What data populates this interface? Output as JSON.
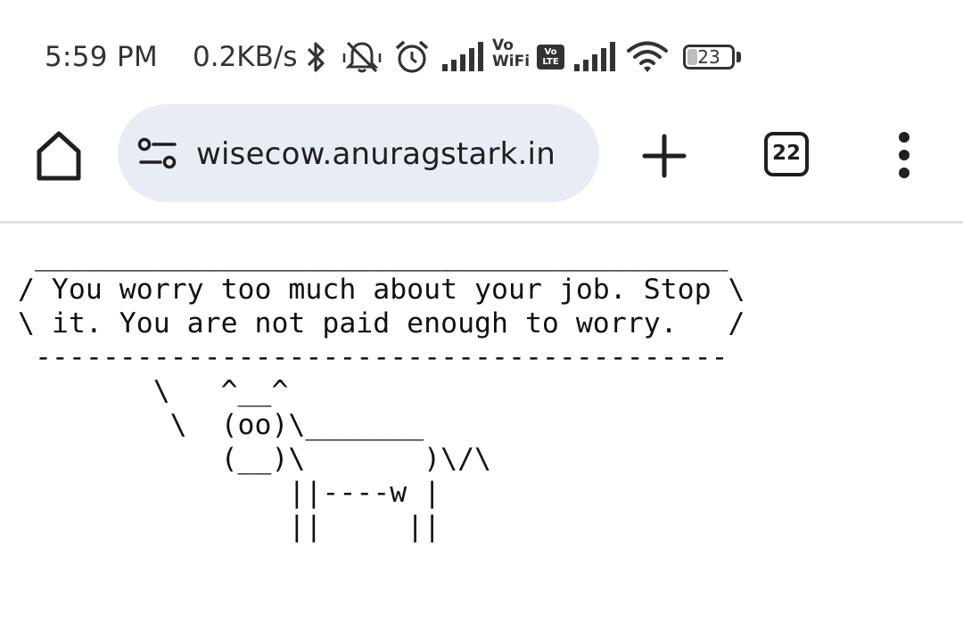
{
  "status_bar": {
    "time": "5:59 PM",
    "net_speed": "0.2KB/s",
    "icons": [
      "bluetooth-icon",
      "mute-icon",
      "alarm-icon",
      "signal-icon",
      "vowifi-icon",
      "volte-icon",
      "signal-icon",
      "wifi-icon",
      "battery-icon"
    ],
    "vowifi_top": "Vo",
    "vowifi_bottom": "WiFi",
    "volte_top": "Vo",
    "volte_bottom": "LTE",
    "battery_percent": "23",
    "battery_level": 0.23
  },
  "browser": {
    "url": "wisecow.anuragstark.in",
    "tab_count": "22",
    "icons": {
      "home": "home-icon",
      "site_info": "tune-icon",
      "new_tab": "plus-icon",
      "menu": "more-vert-icon"
    }
  },
  "page": {
    "cowsay": " _________________________________________\n/ You worry too much about your job. Stop \\\n\\ it. You are not paid enough to worry.   /\n -----------------------------------------\n        \\   ^__^\n         \\  (oo)\\_______\n            (__)\\       )\\/\\\n                ||----w |\n                ||     ||"
  },
  "colors": {
    "pill_bg": "#e8ecf5",
    "icon": "#1f1f1f",
    "divider": "#e2e2e2"
  }
}
